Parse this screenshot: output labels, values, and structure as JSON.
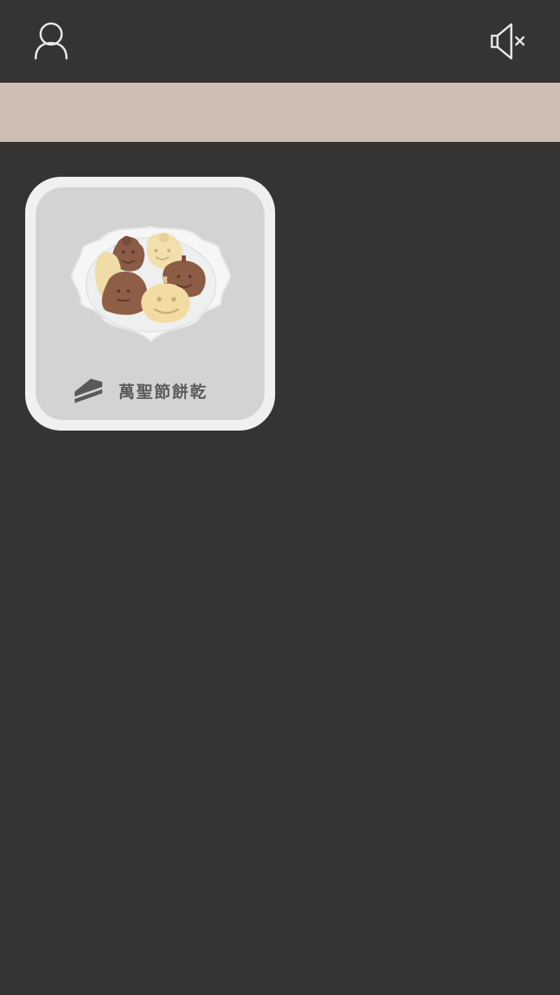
{
  "header": {
    "profile_icon": "user-icon",
    "sound_icon": "speaker-muted-icon"
  },
  "colors": {
    "background": "#353433",
    "banner": "#cebfb4",
    "card_outer": "#eff0ef",
    "card_inner": "#d3d3d3",
    "label_text": "#5a5a5a"
  },
  "recipes": [
    {
      "title": "萬聖節餅乾",
      "icon": "cake-slice-icon",
      "image": "halloween-cookies-plate"
    }
  ]
}
